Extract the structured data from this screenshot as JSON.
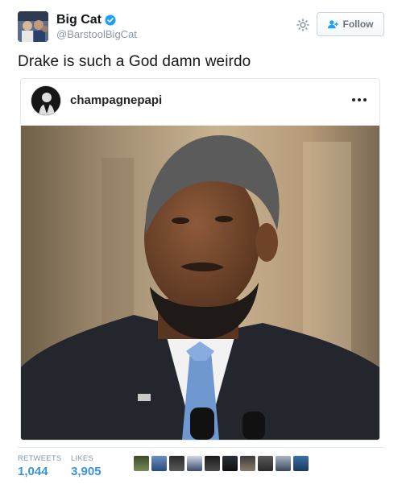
{
  "tweet": {
    "user_name": "Big Cat",
    "user_handle": "@BarstoolBigCat",
    "follow_label": "Follow",
    "text": "Drake is such a God damn weirdo"
  },
  "embed": {
    "username": "champagnepapi",
    "more_icon": "more-dots-icon",
    "image_icon": "photo-portrait"
  },
  "stats": {
    "retweets_label": "RETWEETS",
    "retweets_value": "1,044",
    "likes_label": "LIKES",
    "likes_value": "3,905",
    "liker_count": 10
  },
  "colors": {
    "accent": "#3b94d9",
    "verified": "#1da1f2",
    "muted": "#8899a6"
  },
  "icons": [
    "verified-badge-icon",
    "gear-icon",
    "follow-user-icon",
    "more-dots-icon"
  ]
}
